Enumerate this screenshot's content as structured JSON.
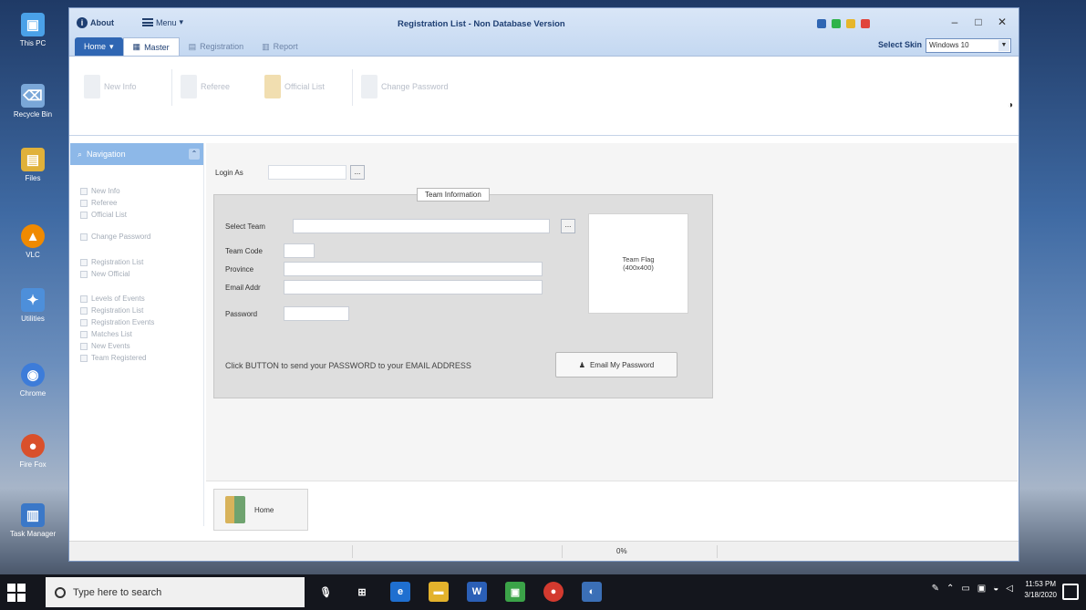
{
  "desktop": {
    "icons": [
      {
        "label": "This PC",
        "icon": "this-pc-icon",
        "color": "#4aa1e8"
      },
      {
        "label": "Recycle Bin",
        "icon": "recycle-bin-icon",
        "color": "#7aa7d8"
      },
      {
        "label": "Files",
        "icon": "folder-icon",
        "color": "#e0b13a"
      },
      {
        "label": "VLC",
        "icon": "media-icon",
        "color": "#f08a00"
      },
      {
        "label": "Utilities",
        "icon": "utilities-icon",
        "color": "#4d8fda"
      },
      {
        "label": "Chrome",
        "icon": "browser-icon",
        "color": "#3d7cd9"
      },
      {
        "label": "Fire Fox",
        "icon": "firefox-icon",
        "color": "#d9502b"
      },
      {
        "label": "Task Manager",
        "icon": "task-manager-icon",
        "color": "#3b78c8"
      }
    ]
  },
  "window": {
    "title": "Registration List - Non Database Version",
    "about_label": "About",
    "menu_label": "Menu",
    "tabs": [
      {
        "label": "Home",
        "active": false,
        "file": true
      },
      {
        "label": "Master",
        "active": true,
        "file": false
      },
      {
        "label": "Registration",
        "active": false,
        "file": false
      },
      {
        "label": "Report",
        "active": false,
        "file": false
      }
    ],
    "skin_label": "Select Skin",
    "skin_value": "Windows 10"
  },
  "ribbon": {
    "buttons": [
      {
        "label": "New Info"
      },
      {
        "label": "Referee"
      },
      {
        "label": "Official List"
      },
      {
        "label": "Change Password"
      }
    ]
  },
  "nav": {
    "header": "Navigation",
    "items": [
      "New Info",
      "Referee",
      "Official List",
      "Change Password",
      "Registration List",
      "New Official",
      "Levels of Events",
      "Registration List",
      "Registration Events",
      "Matches List",
      "New Events",
      "Team Registered"
    ]
  },
  "main": {
    "login_label": "Login As",
    "login_button": "...",
    "group_title": "Team Information",
    "fields": {
      "select_team": "Select Team",
      "team_code": "Team Code",
      "province": "Province",
      "email_address": "Email Addr",
      "password": "Password"
    },
    "pick_button": "...",
    "flag_label_line1": "Team Flag",
    "flag_label_line2": "(400x400)",
    "hint": "Click BUTTON to send your PASSWORD to your EMAIL ADDRESS",
    "email_button": "Email My Password"
  },
  "home": {
    "label": "Home"
  },
  "statusbar": {
    "progress": "0%"
  },
  "taskbar": {
    "search_placeholder": "Type here to search",
    "time": "11:53 PM",
    "date": "3/18/2020"
  }
}
